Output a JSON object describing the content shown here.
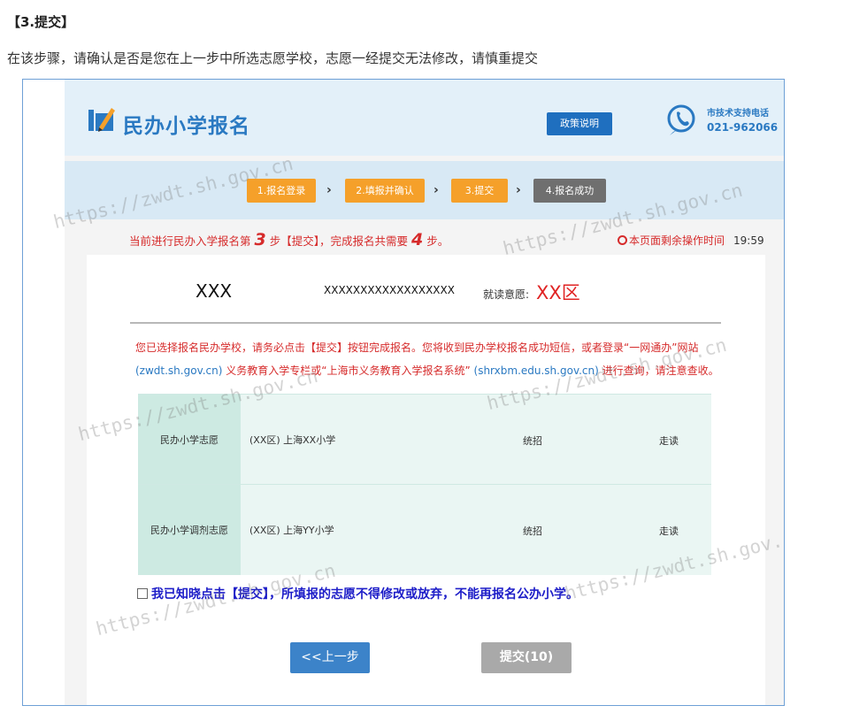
{
  "doc": {
    "heading": "【3.提交】",
    "instruction": "在该步骤，请确认是否是您在上一步中所选志愿学校，志愿一经提交无法修改，请慎重提交"
  },
  "header": {
    "logo_text": "民办小学报名",
    "policy_button": "政策说明",
    "support_title": "市技术支持电话",
    "support_number": "021-962066"
  },
  "steps": [
    {
      "label": "1.报名登录",
      "state": "active"
    },
    {
      "label": "2.填报并确认",
      "state": "active"
    },
    {
      "label": "3.提交",
      "state": "active"
    },
    {
      "label": "4.报名成功",
      "state": "inactive"
    }
  ],
  "status": {
    "prefix": "当前进行民办入学报名第",
    "current_step": "3",
    "middle": "步【提交】，完成报名共需要",
    "total_steps": "4",
    "suffix": "步。",
    "timer_label": "本页面剩余操作时间",
    "timer_value": "19:59"
  },
  "applicant": {
    "name": "XXX",
    "id": "XXXXXXXXXXXXXXXXXX",
    "intent_label": "就读意愿:",
    "intent_value": "XX区"
  },
  "notice": {
    "line1": "您已选择报名民办学校，请务必点击【提交】按钮完成报名。您将收到民办学校报名成功短信，或者登录“一网通办”网站",
    "link1": "(zwdt.sh.gov.cn)",
    "line2_mid": " 义务教育入学专栏或“上海市义务教育入学报名系统” ",
    "link2": "(shrxbm.edu.sh.gov.cn)",
    "line2_end": " 进行查询，请注意查收。"
  },
  "wishes": [
    {
      "label": "民办小学志愿",
      "school": "(XX区) 上海XX小学",
      "type": "统招",
      "mode": "走读"
    },
    {
      "label": "民办小学调剂志愿",
      "school": "(XX区) 上海YY小学",
      "type": "统招",
      "mode": "走读"
    }
  ],
  "agreement": "我已知晓点击【提交】，所填报的志愿不得修改或放弃，不能再报名公办小学。",
  "buttons": {
    "prev": "<<上一步",
    "submit": "提交(10)"
  },
  "watermark_text": "https://zwdt.sh.gov.cn",
  "colors": {
    "brand_blue": "#2a79c2",
    "step_active": "#f5a02a",
    "step_inactive": "#6f6f6f",
    "alert_red": "#d62b2b",
    "agree_blue": "#1d1dc8"
  }
}
